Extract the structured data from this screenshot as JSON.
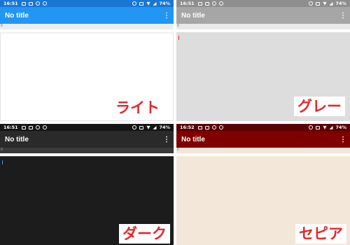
{
  "themes": [
    {
      "status": {
        "time": "16:51",
        "battery": "74%"
      },
      "appbar": {
        "title": "No title",
        "menu_icon": "⋮"
      },
      "counter": "0",
      "label": "ライト",
      "colors": {
        "appbar": "#2196f3",
        "editor": "#ffffff"
      }
    },
    {
      "status": {
        "time": "16:51",
        "battery": "74%"
      },
      "appbar": {
        "title": "No title",
        "menu_icon": "⋮"
      },
      "counter": "0",
      "label": "グレー",
      "colors": {
        "appbar": "#a6a6a6",
        "editor": "#dddddd"
      }
    },
    {
      "status": {
        "time": "16:51",
        "battery": "74%"
      },
      "appbar": {
        "title": "No title",
        "menu_icon": "⋮"
      },
      "counter": "0",
      "label": "ダーク",
      "colors": {
        "appbar": "#2a2a2a",
        "editor": "#1c1c1c"
      }
    },
    {
      "status": {
        "time": "16:52",
        "battery": "74%"
      },
      "appbar": {
        "title": "No title",
        "menu_icon": "⋮"
      },
      "counter": "0",
      "label": "セピア",
      "colors": {
        "appbar": "#800000",
        "editor": "#f3e7da"
      }
    }
  ],
  "label_color": "#e8262a"
}
